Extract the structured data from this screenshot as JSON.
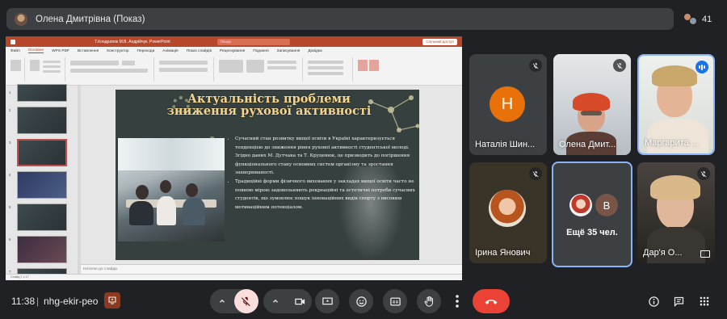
{
  "presenter_bar": {
    "title": "Олена Дмитрівна (Показ)"
  },
  "participants": {
    "count": "41"
  },
  "powerpoint": {
    "file_title": "7.Кондратюк М.В. Андрійчук. PowerPoint",
    "search_placeholder": "Пошук",
    "share_label": "Спільний доступ",
    "tabs": [
      "Файл",
      "Основне",
      "WPS PDF",
      "Вставлення",
      "Конструктор",
      "Переходи",
      "Анімація",
      "Показ слайдів",
      "Рецензування",
      "Подання",
      "Записування",
      "Довідка"
    ],
    "active_tab": "Основне",
    "thumbnail_numbers": [
      "1",
      "2",
      "3",
      "4",
      "5",
      "6",
      "7",
      "8"
    ],
    "notes_placeholder": "Нотатки до слайда",
    "status_text": "Слайд 7 з 17"
  },
  "slide": {
    "title": "Актуальність проблеми зниження рухової активності",
    "bullets": [
      "Сучасний стан розвитку вищої освіти в Україні характеризується тенденцією до зниження рівня рухової активності студентської молоді. Згідно даних М. Дутчака та Т. Круценюк, це призводить до погіршення функціонального стану основних систем організму та зростання захворюваності.",
      "Традиційні форми фізичного виховання у закладах вищої освіти часто не повною мірою задовольняють рекреаційні та естетичні потреби сучасних студентів, що зумовлює пошук інноваційних видів спорту з високим мотиваційним потенціалом."
    ]
  },
  "tiles": [
    {
      "name": "Наталія Шин...",
      "avatar_letter": "Н",
      "muted": true,
      "avatar_color": "#e8710a"
    },
    {
      "name": "Олена Дмит...",
      "muted": true
    },
    {
      "name": "Маргарита ...",
      "speaking": true
    },
    {
      "name": "Ірина Янович",
      "muted": true
    },
    {
      "name": "Ещё 35 чел.",
      "avatar_letter": "В",
      "avatar_color": "#795548"
    },
    {
      "name": "Дар'я О...",
      "muted": true
    }
  ],
  "bottom_bar": {
    "time": "11:38",
    "separator": "|",
    "meeting_code": "nhg-ekir-peo"
  },
  "colors": {
    "background": "#202124",
    "tile_bg": "#3c4043",
    "end_call": "#ea4335",
    "mic_off": "#f9dedc",
    "slide_title": "#f4d58d",
    "accent_blue": "#8ab4f8"
  },
  "icons": [
    "chevron-up-icon",
    "mic-off-icon",
    "camera-icon",
    "present-screen-icon",
    "emoji-icon",
    "captions-icon",
    "raise-hand-icon",
    "more-vert-icon",
    "end-call-icon",
    "info-icon",
    "chat-icon",
    "apps-grid-icon"
  ]
}
